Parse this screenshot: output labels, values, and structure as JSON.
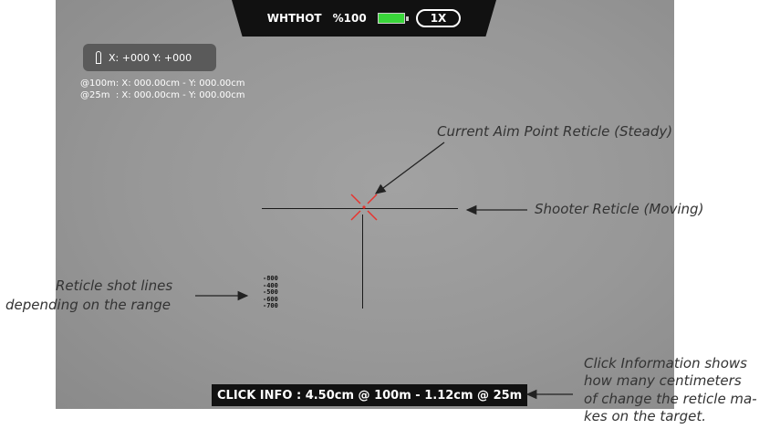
{
  "status_bar": {
    "mode": "WHTHOT",
    "battery_text": "%100",
    "battery_level": 1.0,
    "zoom": "1X"
  },
  "coords": {
    "text": "X: +000 Y: +000",
    "line_100m": "@100m: X: 000.00cm - Y: 000.00cm",
    "line_25m": "@25m  : X: 000.00cm - Y: 000.00cm"
  },
  "ladder": [
    "-800",
    "-400",
    "-500",
    "-600",
    "-700"
  ],
  "click_info": "CLICK INFO : 4.50cm @ 100m - 1.12cm @ 25m",
  "annotations": {
    "aim_point": "Current Aim Point Reticle (Steady)",
    "shooter": "Shooter Reticle (Moving)",
    "shot_lines_1": "Reticle shot lines",
    "shot_lines_2": "depending on the range",
    "click_info_1": "Click Information shows",
    "click_info_2": "how many centimeters",
    "click_info_3": "of change the reticle ma-",
    "click_info_4": "kes on the target."
  },
  "colors": {
    "aim_reticle": "#e8332e",
    "battery": "#39d63a"
  }
}
